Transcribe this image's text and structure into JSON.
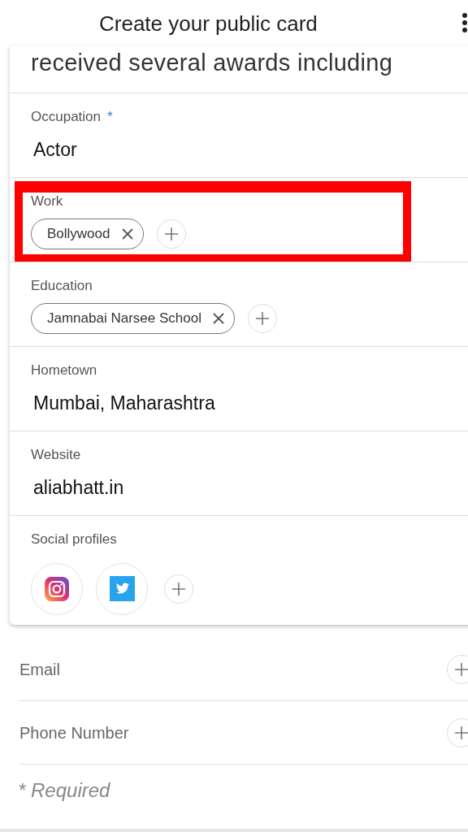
{
  "app_bar": {
    "title": "Create your public card"
  },
  "card": {
    "top_text": "received several awards including",
    "fields": [
      {
        "kind": "text",
        "label": "Occupation",
        "required_mark": "*",
        "highlighted": false,
        "value": "Actor"
      },
      {
        "kind": "chips",
        "label": "Work",
        "highlighted": true,
        "chips": [
          "Bollywood"
        ]
      },
      {
        "kind": "chips",
        "label": "Education",
        "highlighted": false,
        "chips": [
          "Jamnabai Narsee School"
        ]
      },
      {
        "kind": "text",
        "label": "Hometown",
        "highlighted": false,
        "value": "Mumbai, Maharashtra"
      },
      {
        "kind": "text",
        "label": "Website",
        "highlighted": false,
        "value": "aliabhatt.in"
      },
      {
        "kind": "social",
        "label": "Social profiles",
        "highlighted": false,
        "profiles": [
          {
            "kind": "instagram"
          },
          {
            "kind": "twitter"
          }
        ]
      }
    ]
  },
  "extra_fields": [
    {
      "label": "Email"
    },
    {
      "label": "Phone Number"
    }
  ],
  "footnote": "* Required"
}
